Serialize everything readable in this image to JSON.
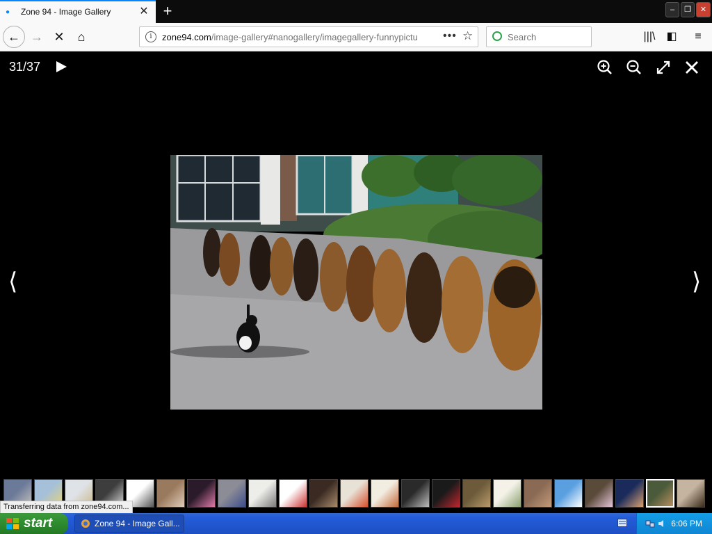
{
  "tab": {
    "title": "Zone 94 - Image Gallery",
    "close_glyph": "✕"
  },
  "new_tab_glyph": "+",
  "window_controls": {
    "minimize": "‒",
    "restore": "❐",
    "close": "✕"
  },
  "nav": {
    "back_glyph": "←",
    "forward_glyph": "→",
    "stop_glyph": "✕",
    "home_glyph": "⌂",
    "url_host": "zone94.com",
    "url_path": "/image-gallery#nanogallery/imagegallery-funnypictu",
    "page_actions_glyph": "•••",
    "bookmark_glyph": "☆",
    "search_placeholder": "Search",
    "library_glyph": "|||\\",
    "sidebar_glyph": "◧",
    "menu_glyph": "≡"
  },
  "gallery": {
    "counter": "31/37",
    "prev_glyph": "⟨",
    "next_glyph": "⟩",
    "photo_subject": "cat walking past a row of seated german shepherd dogs",
    "thumbnails": [
      {
        "colors": [
          "#6b7a99",
          "#c7c2bd"
        ]
      },
      {
        "colors": [
          "#a5c0d8",
          "#e6d37a"
        ]
      },
      {
        "colors": [
          "#dfe3e8",
          "#c9b88a"
        ]
      },
      {
        "colors": [
          "#3d3d3d",
          "#d8d8d8"
        ]
      },
      {
        "colors": [
          "#ffffff",
          "#555555"
        ]
      },
      {
        "colors": [
          "#9a7a5e",
          "#e0cbb8"
        ]
      },
      {
        "colors": [
          "#2a1a2a",
          "#e07aa8"
        ]
      },
      {
        "colors": [
          "#8c8c96",
          "#3d4d8c"
        ]
      },
      {
        "colors": [
          "#ededea",
          "#7b7b7b"
        ]
      },
      {
        "colors": [
          "#ffffff",
          "#cc3333"
        ]
      },
      {
        "colors": [
          "#3a2a22",
          "#a88a6c"
        ]
      },
      {
        "colors": [
          "#e7e1d6",
          "#d94e2a"
        ]
      },
      {
        "colors": [
          "#f2ede1",
          "#c46a3a"
        ]
      },
      {
        "colors": [
          "#2a2a2a",
          "#bdbdbd"
        ]
      },
      {
        "colors": [
          "#1a1a1a",
          "#c0262e"
        ]
      },
      {
        "colors": [
          "#6c5a3a",
          "#b99b6b"
        ]
      },
      {
        "colors": [
          "#f4f2e8",
          "#8aa070"
        ]
      },
      {
        "colors": [
          "#8a6a54",
          "#c49a7a"
        ]
      },
      {
        "colors": [
          "#5aa0e0",
          "#ffffff"
        ]
      },
      {
        "colors": [
          "#5a4a3a",
          "#e4c4d8"
        ]
      },
      {
        "colors": [
          "#1a2a5a",
          "#d8a070"
        ]
      },
      {
        "colors": [
          "#4a5a3a",
          "#b89060"
        ]
      },
      {
        "colors": [
          "#c4b4a0",
          "#3a2a1a"
        ]
      }
    ],
    "active_thumbnail_index": 21
  },
  "status_text": "Transferring data from zone94.com...",
  "taskbar": {
    "start_label": "start",
    "task_label": "Zone 94 - Image Gall...",
    "clock": "6:06 PM"
  },
  "colors": {
    "accent": "#0a84ff",
    "viewer_bg": "#000000",
    "taskbar_blue": "#245dd9",
    "start_green": "#2e8b2e"
  }
}
